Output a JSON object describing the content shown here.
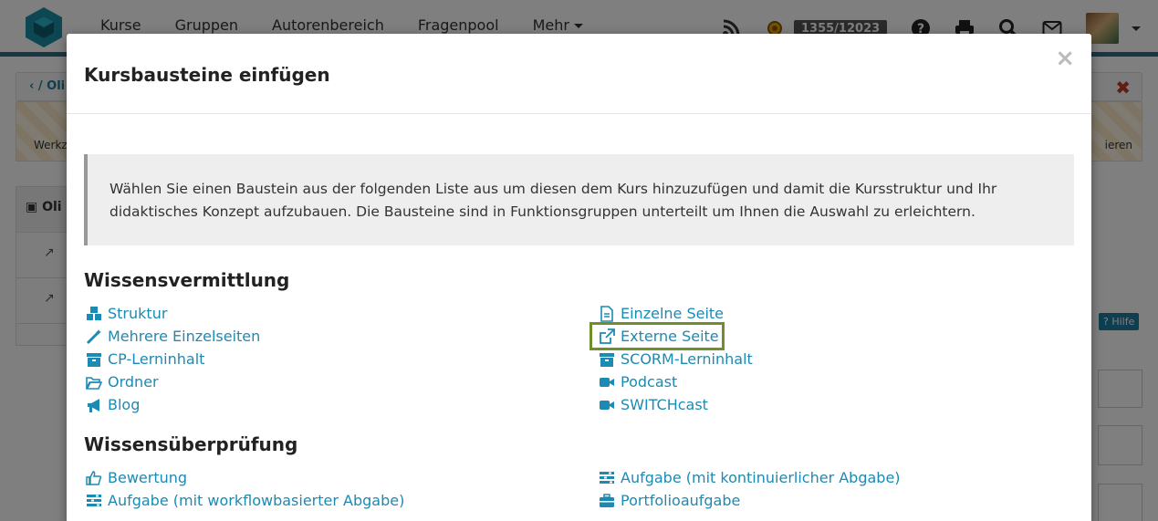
{
  "topbar": {
    "nav": [
      "Kurse",
      "Gruppen",
      "Autorenbereich",
      "Fragenpool",
      "Mehr"
    ],
    "score": "1355/12023",
    "icons": [
      "rss-icon",
      "coin-icon",
      "help-icon",
      "print-icon",
      "search-icon",
      "mail-icon",
      "avatar"
    ]
  },
  "background": {
    "breadcrumb_text": "Oli",
    "tool_left": "Werkz",
    "tool_right": "ieren",
    "tree_title": "Oli",
    "help_label": "Hilfe"
  },
  "modal": {
    "title": "Kursbausteine einfügen",
    "close_symbol": "×",
    "info": "Wählen Sie einen Baustein aus der folgenden Liste aus um diesen dem Kurs hinzuzufügen und damit die Kursstruktur und Ihr didaktisches Konzept aufzubauen. Die Bausteine sind in Funktionsgruppen unterteilt um Ihnen die Auswahl zu erleichtern.",
    "sections": [
      {
        "title": "Wissensvermittlung",
        "left": [
          {
            "label": "Struktur",
            "icon": "cubes-icon"
          },
          {
            "label": "Mehrere Einzelseiten",
            "icon": "magic-wand-icon"
          },
          {
            "label": "CP-Lerninhalt",
            "icon": "archive-icon"
          },
          {
            "label": "Ordner",
            "icon": "folder-open-icon"
          },
          {
            "label": "Blog",
            "icon": "bullhorn-icon"
          }
        ],
        "right": [
          {
            "label": "Einzelne Seite",
            "icon": "file-text-icon"
          },
          {
            "label": "Externe Seite",
            "icon": "external-link-icon",
            "selected": true
          },
          {
            "label": "SCORM-Lerninhalt",
            "icon": "archive-icon"
          },
          {
            "label": "Podcast",
            "icon": "video-camera-icon"
          },
          {
            "label": "SWITCHcast",
            "icon": "video-camera-icon"
          }
        ]
      },
      {
        "title": "Wissensüberprüfung",
        "left": [
          {
            "label": "Bewertung",
            "icon": "thumbs-up-icon"
          },
          {
            "label": "Aufgabe (mit workflowbasierter Abgabe)",
            "icon": "tasks-icon"
          }
        ],
        "right": [
          {
            "label": "Aufgabe (mit kontinuierlicher Abgabe)",
            "icon": "tasks-icon"
          },
          {
            "label": "Portfolioaufgabe",
            "icon": "briefcase-icon"
          }
        ]
      }
    ]
  },
  "colors": {
    "link": "#1d8ab3",
    "selected_outline": "#6f8f2a",
    "brand": "#2f6e8b"
  }
}
